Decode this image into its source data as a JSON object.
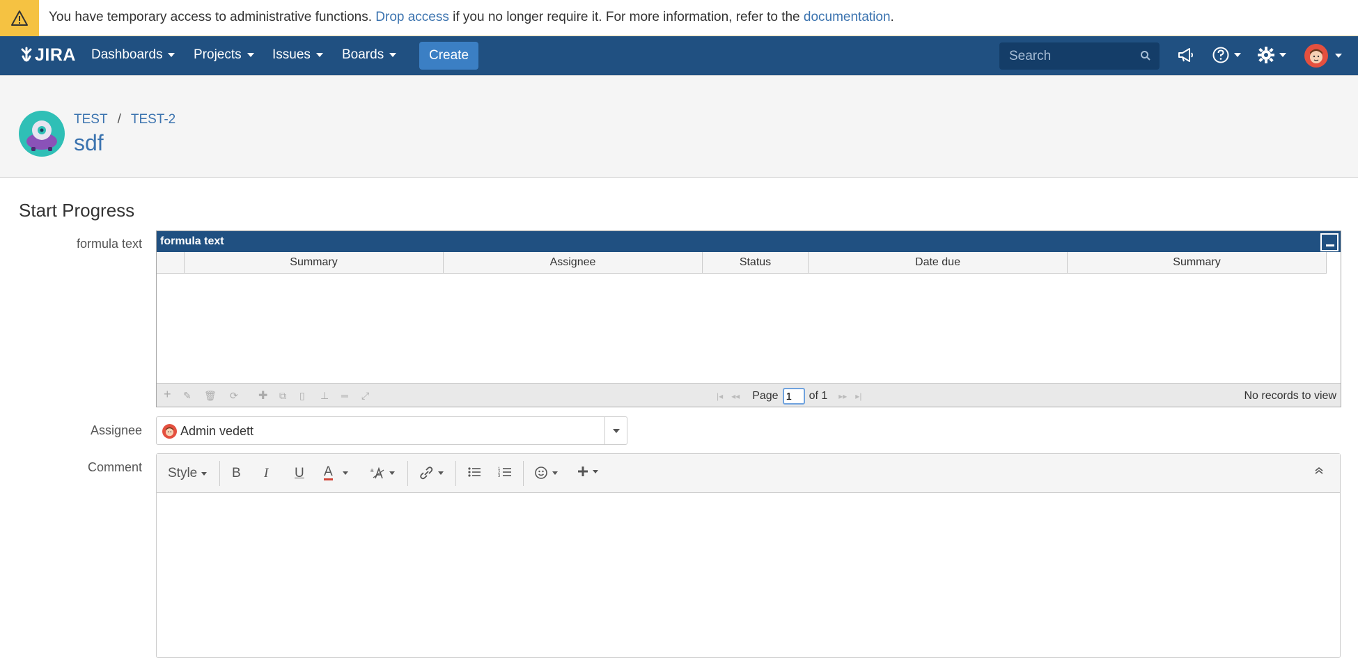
{
  "banner": {
    "text_before": "You have temporary access to administrative functions.",
    "drop_link": "Drop access",
    "text_middle": "if you no longer require it. For more information, refer to the",
    "doc_link": "documentation",
    "text_end": "."
  },
  "nav": {
    "logo_text": "JIRA",
    "items": [
      "Dashboards",
      "Projects",
      "Issues",
      "Boards"
    ],
    "create_label": "Create",
    "search_placeholder": "Search"
  },
  "header": {
    "project_key": "TEST",
    "separator": "/",
    "issue_key": "TEST-2",
    "issue_summary": "sdf"
  },
  "form": {
    "title": "Start Progress",
    "formula_label": "formula text",
    "assignee_label": "Assignee",
    "comment_label": "Comment"
  },
  "grid": {
    "caption": "formula text",
    "columns": [
      "",
      "Summary",
      "Assignee",
      "Status",
      "Date due",
      "Summary"
    ],
    "pager": {
      "page_label": "Page",
      "page_value": "1",
      "of_label": "of 1",
      "records_text": "No records to view"
    }
  },
  "assignee": {
    "value": "Admin vedett"
  },
  "editor": {
    "style_label": "Style",
    "bold": "B",
    "italic": "I",
    "underline": "U",
    "text_color": "A"
  },
  "colors": {
    "nav_bg": "#205081",
    "link": "#3b73af",
    "warning": "#f5c242",
    "create_btn": "#3b7fc4"
  }
}
